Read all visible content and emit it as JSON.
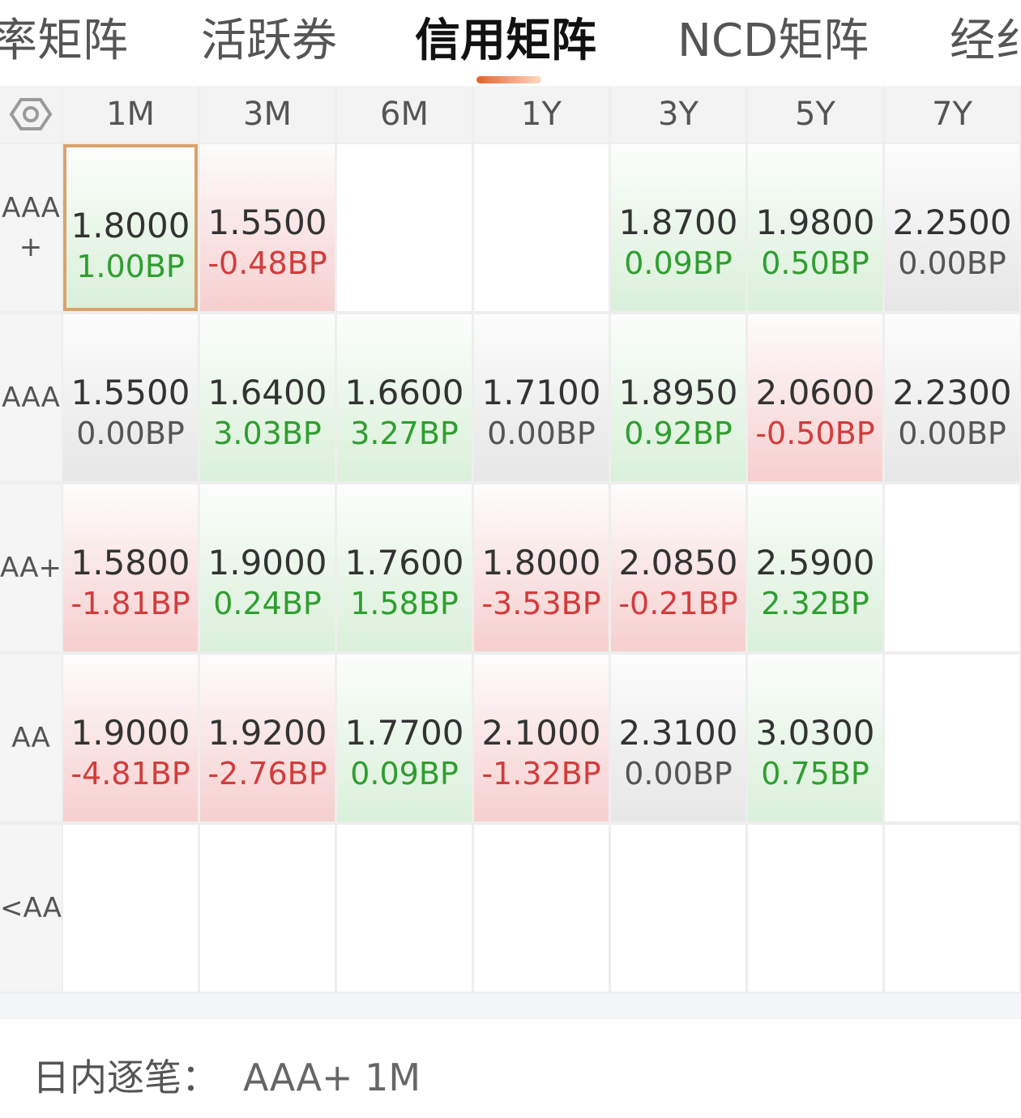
{
  "tabs": [
    {
      "label": "率矩阵",
      "active": false
    },
    {
      "label": "活跃券",
      "active": false
    },
    {
      "label": "信用矩阵",
      "active": true
    },
    {
      "label": "NCD矩阵",
      "active": false
    },
    {
      "label": "经纟",
      "active": false
    }
  ],
  "icons": {
    "settings": "hexagon-settings-icon"
  },
  "columns": [
    "1M",
    "3M",
    "6M",
    "1Y",
    "3Y",
    "5Y",
    "7Y"
  ],
  "rows": [
    {
      "label": "AAA+",
      "cells": [
        {
          "value": "1.8000",
          "change": "1.00BP",
          "dir": "up",
          "selected": true
        },
        {
          "value": "1.5500",
          "change": "-0.48BP",
          "dir": "down"
        },
        null,
        null,
        {
          "value": "1.8700",
          "change": "0.09BP",
          "dir": "up"
        },
        {
          "value": "1.9800",
          "change": "0.50BP",
          "dir": "up"
        },
        {
          "value": "2.2500",
          "change": "0.00BP",
          "dir": "flat"
        }
      ]
    },
    {
      "label": "AAA",
      "cells": [
        {
          "value": "1.5500",
          "change": "0.00BP",
          "dir": "flat"
        },
        {
          "value": "1.6400",
          "change": "3.03BP",
          "dir": "up"
        },
        {
          "value": "1.6600",
          "change": "3.27BP",
          "dir": "up"
        },
        {
          "value": "1.7100",
          "change": "0.00BP",
          "dir": "flat"
        },
        {
          "value": "1.8950",
          "change": "0.92BP",
          "dir": "up"
        },
        {
          "value": "2.0600",
          "change": "-0.50BP",
          "dir": "down"
        },
        {
          "value": "2.2300",
          "change": "0.00BP",
          "dir": "flat"
        }
      ]
    },
    {
      "label": "AA+",
      "cells": [
        {
          "value": "1.5800",
          "change": "-1.81BP",
          "dir": "down"
        },
        {
          "value": "1.9000",
          "change": "0.24BP",
          "dir": "up"
        },
        {
          "value": "1.7600",
          "change": "1.58BP",
          "dir": "up"
        },
        {
          "value": "1.8000",
          "change": "-3.53BP",
          "dir": "down"
        },
        {
          "value": "2.0850",
          "change": "-0.21BP",
          "dir": "down"
        },
        {
          "value": "2.5900",
          "change": "2.32BP",
          "dir": "up"
        },
        null
      ]
    },
    {
      "label": "AA",
      "cells": [
        {
          "value": "1.9000",
          "change": "-4.81BP",
          "dir": "down"
        },
        {
          "value": "1.9200",
          "change": "-2.76BP",
          "dir": "down"
        },
        {
          "value": "1.7700",
          "change": "0.09BP",
          "dir": "up"
        },
        {
          "value": "2.1000",
          "change": "-1.32BP",
          "dir": "down"
        },
        {
          "value": "2.3100",
          "change": "0.00BP",
          "dir": "flat"
        },
        {
          "value": "3.0300",
          "change": "0.75BP",
          "dir": "up"
        },
        null
      ]
    },
    {
      "label": "<AA",
      "cells": [
        null,
        null,
        null,
        null,
        null,
        null,
        null
      ]
    }
  ],
  "footer": {
    "label": "日内逐笔：",
    "selection": "AAA+ 1M"
  },
  "colors": {
    "up": "#2f9e2f",
    "down": "#d23c3c",
    "accent": "#e8602c",
    "selected_border": "#d9a36b"
  }
}
